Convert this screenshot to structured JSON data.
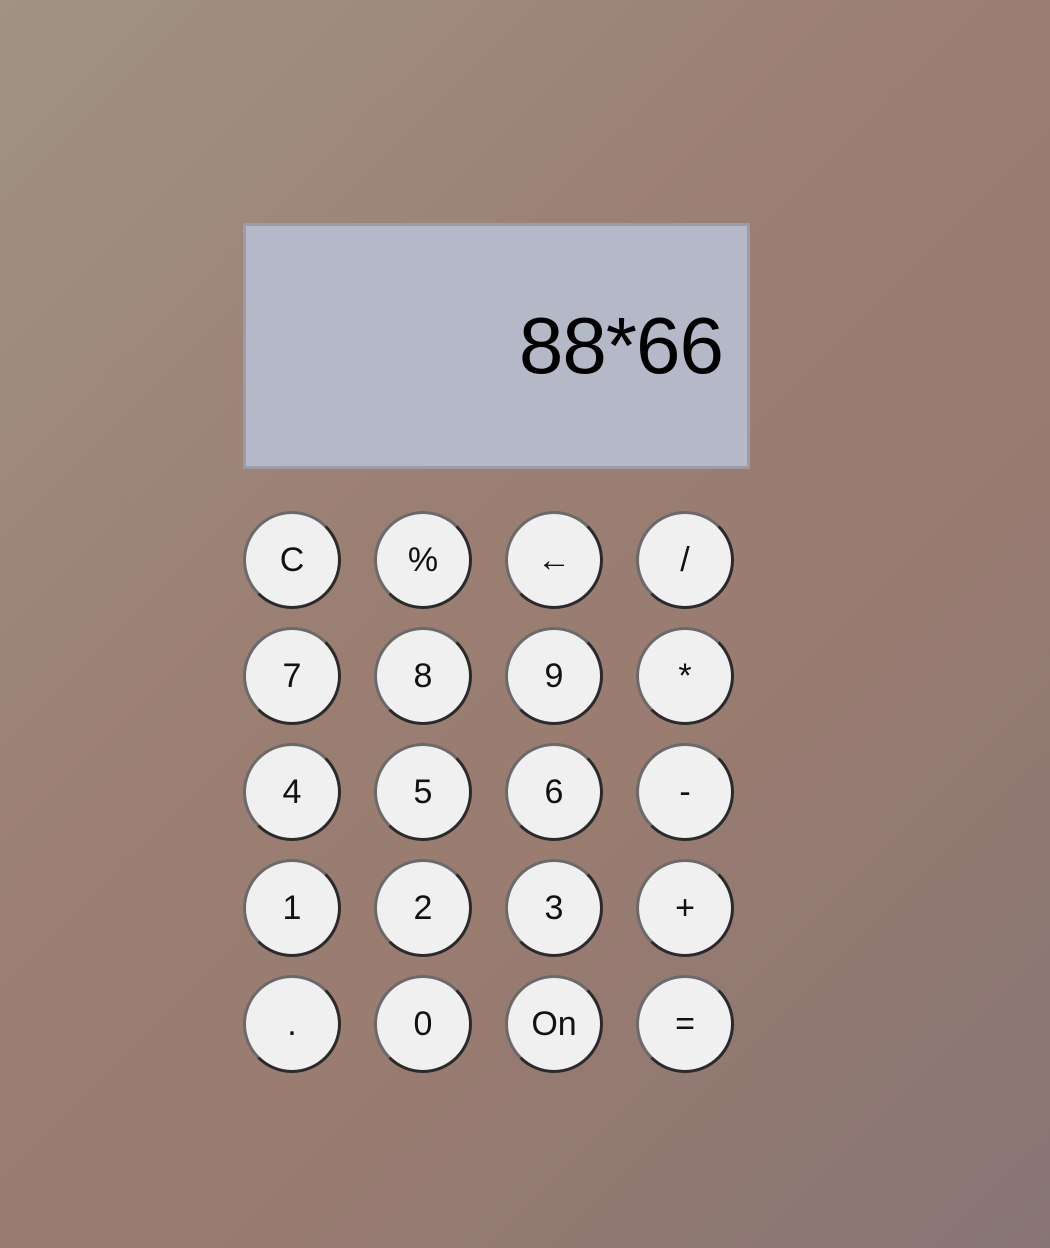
{
  "display": {
    "value": "88*66"
  },
  "keys": [
    {
      "label": "C"
    },
    {
      "label": "%"
    },
    {
      "label": "←"
    },
    {
      "label": "/"
    },
    {
      "label": "7"
    },
    {
      "label": "8"
    },
    {
      "label": "9"
    },
    {
      "label": "*"
    },
    {
      "label": "4"
    },
    {
      "label": "5"
    },
    {
      "label": "6"
    },
    {
      "label": "-"
    },
    {
      "label": "1"
    },
    {
      "label": "2"
    },
    {
      "label": "3"
    },
    {
      "label": "+"
    },
    {
      "label": "."
    },
    {
      "label": "0"
    },
    {
      "label": "On"
    },
    {
      "label": "="
    }
  ]
}
